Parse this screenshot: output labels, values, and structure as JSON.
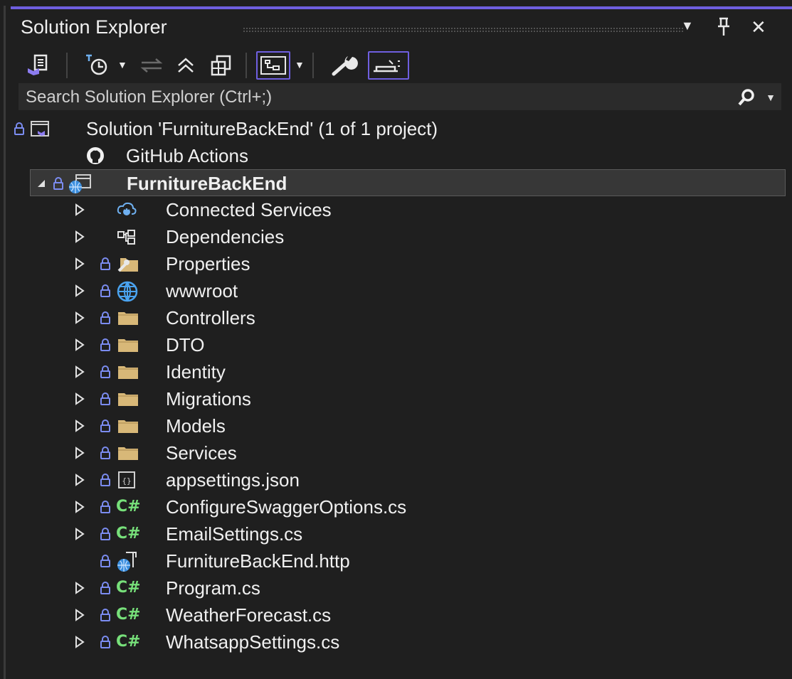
{
  "window": {
    "title": "Solution Explorer",
    "controls": {
      "dropdown": "▼",
      "pin": "⊥",
      "close": "✕"
    }
  },
  "search": {
    "placeholder": "Search Solution Explorer (Ctrl+;)"
  },
  "colors": {
    "accent": "#6f5fe0",
    "lock": "#7b8cf0",
    "csharp": "#77e07a",
    "folder": "#d8b878",
    "background": "#1f1f1f"
  },
  "tree": [
    {
      "label": "Solution 'FurnitureBackEnd' (1 of 1 project)",
      "icon": "solution-icon",
      "locked": true,
      "expander": "none"
    },
    {
      "label": "GitHub Actions",
      "icon": "github-icon",
      "locked": false,
      "expander": "none"
    },
    {
      "label": "FurnitureBackEnd",
      "icon": "web-project-icon",
      "locked": true,
      "expander": "expanded",
      "bold": true,
      "selected": true
    },
    {
      "label": "Connected Services",
      "icon": "connected-services-icon",
      "locked": false,
      "expander": "collapsed"
    },
    {
      "label": "Dependencies",
      "icon": "dependencies-icon",
      "locked": false,
      "expander": "collapsed"
    },
    {
      "label": "Properties",
      "icon": "properties-folder-icon",
      "locked": true,
      "expander": "collapsed"
    },
    {
      "label": "wwwroot",
      "icon": "globe-icon",
      "locked": true,
      "expander": "collapsed"
    },
    {
      "label": "Controllers",
      "icon": "folder-icon",
      "locked": true,
      "expander": "collapsed"
    },
    {
      "label": "DTO",
      "icon": "folder-icon",
      "locked": true,
      "expander": "collapsed"
    },
    {
      "label": "Identity",
      "icon": "folder-icon",
      "locked": true,
      "expander": "collapsed"
    },
    {
      "label": "Migrations",
      "icon": "folder-icon",
      "locked": true,
      "expander": "collapsed"
    },
    {
      "label": "Models",
      "icon": "folder-icon",
      "locked": true,
      "expander": "collapsed"
    },
    {
      "label": "Services",
      "icon": "folder-icon",
      "locked": true,
      "expander": "collapsed"
    },
    {
      "label": "appsettings.json",
      "icon": "json-file-icon",
      "locked": true,
      "expander": "collapsed"
    },
    {
      "label": "ConfigureSwaggerOptions.cs",
      "icon": "csharp-file-icon",
      "locked": true,
      "expander": "collapsed"
    },
    {
      "label": "EmailSettings.cs",
      "icon": "csharp-file-icon",
      "locked": true,
      "expander": "collapsed"
    },
    {
      "label": "FurnitureBackEnd.http",
      "icon": "http-file-icon",
      "locked": true,
      "expander": "none"
    },
    {
      "label": "Program.cs",
      "icon": "csharp-file-icon",
      "locked": true,
      "expander": "collapsed"
    },
    {
      "label": "WeatherForecast.cs",
      "icon": "csharp-file-icon",
      "locked": true,
      "expander": "collapsed"
    },
    {
      "label": "WhatsappSettings.cs",
      "icon": "csharp-file-icon",
      "locked": true,
      "expander": "collapsed"
    }
  ],
  "csharp_badge": "C#"
}
